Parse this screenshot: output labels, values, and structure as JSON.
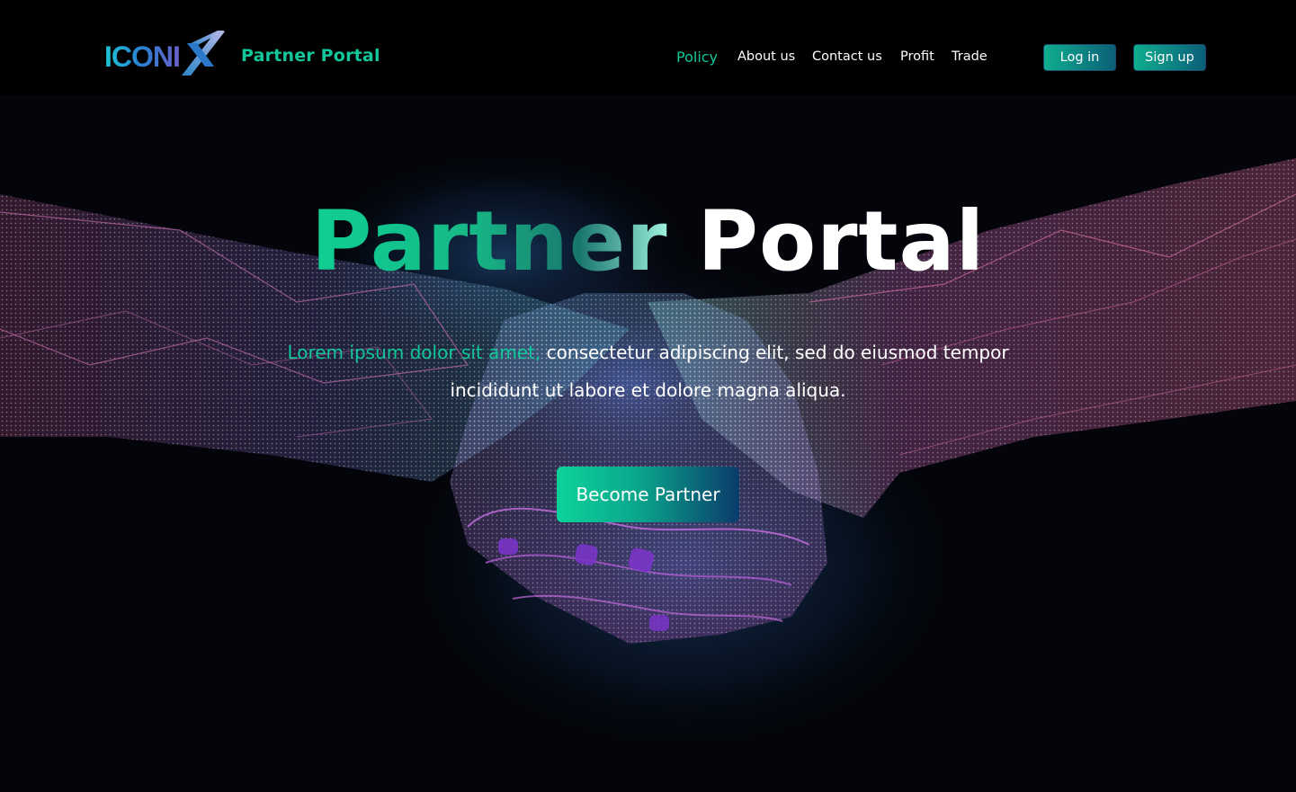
{
  "header": {
    "logo_text": "ICONIX",
    "brand_title": "Partner Portal",
    "nav": [
      {
        "label": "Policy",
        "active": true
      },
      {
        "label": "About us",
        "active": false
      },
      {
        "label": "Contact us",
        "active": false
      },
      {
        "label": "Profit",
        "active": false
      },
      {
        "label": "Trade",
        "active": false
      }
    ],
    "login_label": "Log in",
    "signup_label": "Sign up"
  },
  "hero": {
    "title_part1": "Partner",
    "title_part2": "Portal",
    "subtitle_accent": "Lorem ipsum dolor sit amet,",
    "subtitle_rest": "consectetur adipiscing elit, sed do eiusmod tempor",
    "subtitle_line2": "incididunt ut labore et dolore magna aliqua.",
    "cta_label": "Become Partner",
    "background_icon": "digital-handshake-image"
  },
  "colors": {
    "accent": "#12c79a",
    "background": "#000000",
    "button_gradient_start": "#0fae8f",
    "button_gradient_end": "#0b3b6b"
  }
}
